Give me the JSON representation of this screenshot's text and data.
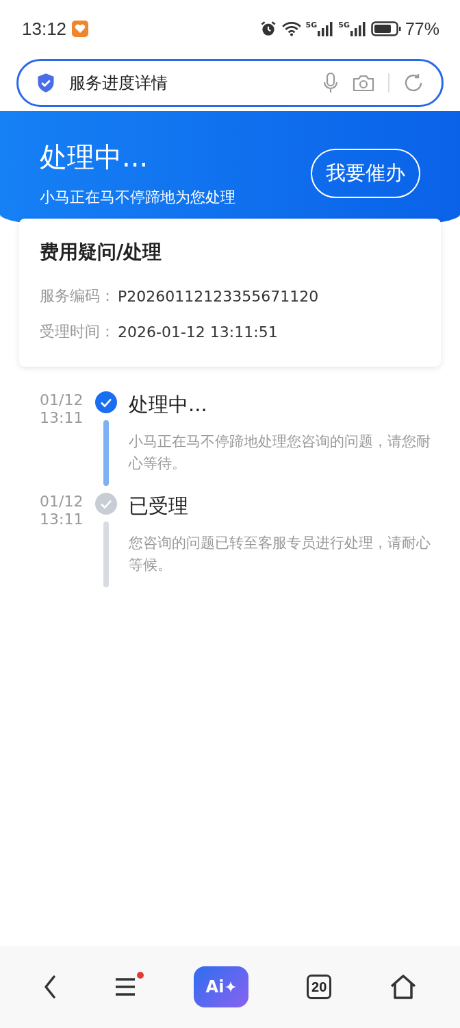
{
  "status_bar": {
    "time": "13:12",
    "signals": [
      "5G",
      "5G"
    ],
    "battery": "77%"
  },
  "search": {
    "value": "服务进度详情"
  },
  "banner": {
    "title": "处理中...",
    "subtitle": "小马正在马不停蹄地为您处理",
    "button": "我要催办"
  },
  "card": {
    "title": "费用疑问/处理",
    "fields": [
      {
        "label": "服务编码：",
        "value": "P20260112123355671120"
      },
      {
        "label": "受理时间：",
        "value": "2026-01-12 13:11:51"
      }
    ]
  },
  "timeline": [
    {
      "date": "01/12",
      "time": "13:11",
      "title": "处理中...",
      "text": "小马正在马不停蹄地处理您咨询的问题，请您耐心等待。",
      "active": true
    },
    {
      "date": "01/12",
      "time": "13:11",
      "title": "已受理",
      "text": "您咨询的问题已转至客服专员进行处理，请耐心等候。",
      "active": false
    }
  ],
  "bottom_nav": {
    "ai_label": "Ai",
    "tabs_count": "20",
    "menu_badge": true
  }
}
